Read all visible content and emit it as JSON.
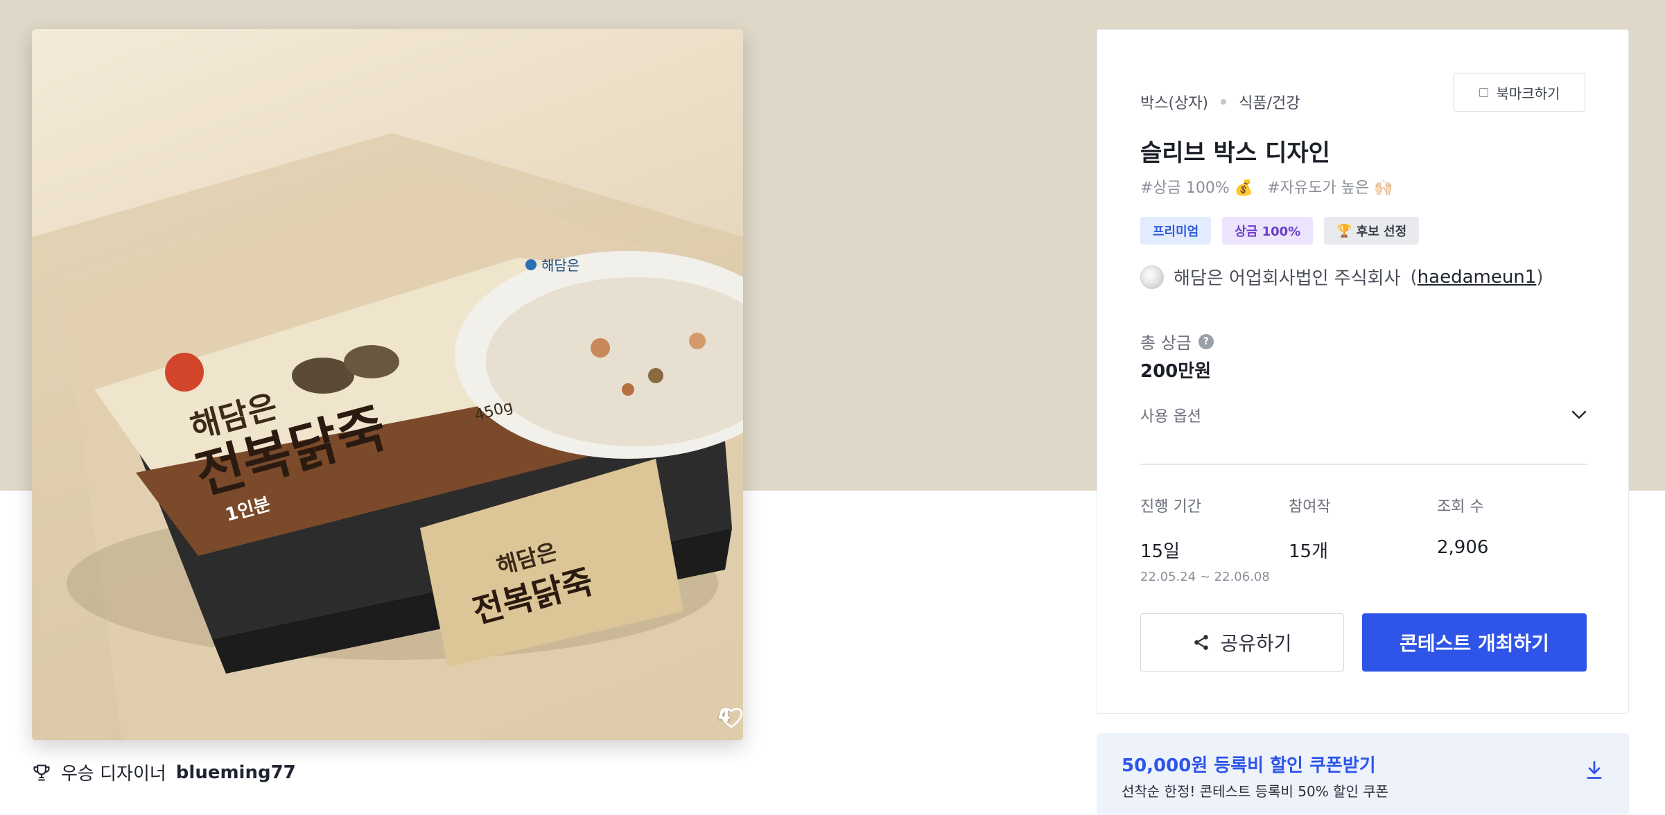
{
  "product": {
    "like_count": "4",
    "winner_label": "우승 디자이너",
    "winner_name": "blueming77"
  },
  "contest": {
    "category_1": "박스(상자)",
    "category_2": "식품/건강",
    "bookmark_label": "북마크하기",
    "title": "슬리브 박스 디자인",
    "hashtags": [
      "#상금 100% 💰",
      "#자유도가 높은 🙌🏻"
    ],
    "badges": {
      "premium": "프리미엄",
      "prize": "상금 100%",
      "candidate": "후보 선정"
    },
    "host_name": "해담은 어업회사법인 주식회사",
    "host_open": "(",
    "host_id": "haedameun1",
    "host_close": ")",
    "prize_label": "총 상금",
    "prize_value": "200만원",
    "usage_label": "사용 옵션",
    "stats": {
      "period_label": "진행 기간",
      "period_value": "15일",
      "period_dates": "22.05.24 ~ 22.06.08",
      "entries_label": "참여작",
      "entries_value": "15개",
      "views_label": "조회 수",
      "views_value": "2,906"
    },
    "share_label": "공유하기",
    "open_label": "콘테스트 개최하기"
  },
  "coupon": {
    "title": "50,000원 등록비 할인 쿠폰받기",
    "subtitle": "선착순 한정! 콘테스트 등록비 50% 할인 쿠폰"
  },
  "packaging_text": {
    "brand": "해담은",
    "product_line_1": "해담은",
    "product_line_2": "전복닭죽",
    "weight": "450g",
    "serving": "1인분",
    "sleeve_line_1": "해담은",
    "sleeve_line_2": "전복닭죽"
  },
  "colors": {
    "accent": "#2e55e8",
    "top_band": "#dfd8c8",
    "premium_bg": "#e2ecfe",
    "prize_bg": "#ece4fc"
  },
  "icons": {
    "like": "heart-icon",
    "winner": "trophy-icon",
    "share": "share-icon",
    "usage": "chevron-down-icon",
    "coupon": "download-icon",
    "help": "question-icon"
  }
}
